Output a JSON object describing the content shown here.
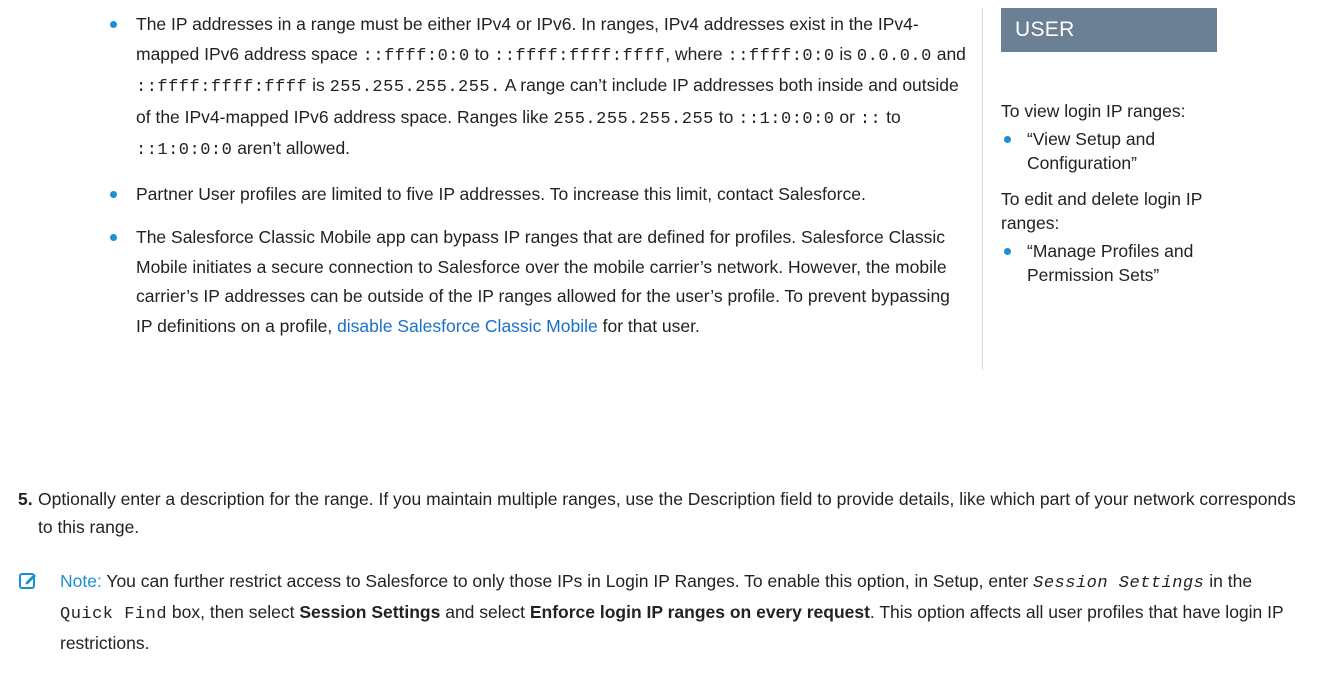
{
  "bullets": [
    {
      "t1": "The IP addresses in a range must be either IPv4 or IPv6. In ranges, IPv4 addresses exist in the IPv4-mapped IPv6 address space ",
      "c1": "::ffff:0:0",
      "t2": " to ",
      "c2": "::ffff:ffff:ffff",
      "t3": ", where ",
      "c3": "::ffff:0:0",
      "t4": " is ",
      "c4": "0.0.0.0",
      "t5": " and ",
      "c5": "::ffff:ffff:ffff",
      "t6": " is ",
      "c6": "255.255.255.255.",
      "t7": " A range can’t include IP addresses both inside and outside of the IPv4-mapped IPv6 address space. Ranges like ",
      "c7": "255.255.255.255",
      "t8": " to ",
      "c8": "::1:0:0:0",
      "t9": " or ",
      "c9": "::",
      "t10": " to ",
      "c10": "::1:0:0:0",
      "t11": " aren’t allowed."
    },
    {
      "text": "Partner User profiles are limited to five IP addresses. To increase this limit, contact Salesforce."
    },
    {
      "text": "The Salesforce Classic Mobile app can bypass IP ranges that are defined for profiles. Salesforce Classic Mobile initiates a secure connection to Salesforce over the mobile carrier’s network. However, the mobile carrier’s IP addresses can be outside of the IP ranges allowed for the user’s profile. To prevent bypassing IP definitions on a profile, ",
      "link": "disable Salesforce Classic Mobile",
      "after": " for that user."
    }
  ],
  "step5": {
    "number": "5.",
    "text": "Optionally enter a description for the range. If you maintain multiple ranges, use the Description field to provide details, like which part of your network corresponds to this range."
  },
  "note": {
    "icon": "note-edit-icon",
    "label": "Note:",
    "t1": "  You can further restrict access to Salesforce to only those IPs in Login IP Ranges. To enable this option, in Setup, enter ",
    "code1": "Session Settings",
    "t2": " in the ",
    "code2": "Quick Find",
    "t3": " box, then select ",
    "b1": "Session Settings",
    "t4": " and select ",
    "b2": "Enforce login IP ranges on every request",
    "t5": ". This option affects all user profiles that have login IP restrictions."
  },
  "sidebar": {
    "title": "USER PERMISSIONS",
    "view_intro": "To view login IP ranges:",
    "view_perm": "“View Setup and Configuration”",
    "edit_intro": "To edit and delete login IP ranges:",
    "edit_perm": "“Manage Profiles and Permission Sets”"
  },
  "colors": {
    "accent": "#1b8fd6",
    "header_bg": "#6c8095",
    "link": "#1a6fc9"
  }
}
